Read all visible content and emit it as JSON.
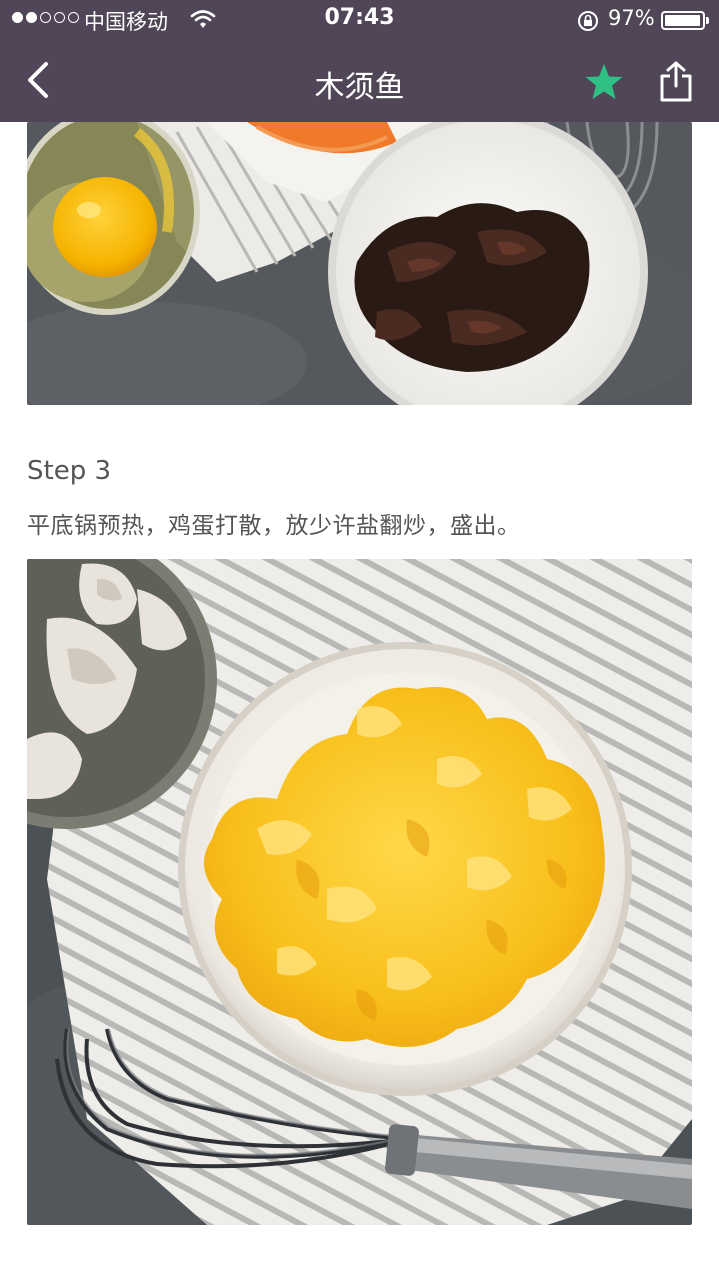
{
  "status_bar": {
    "carrier": "中国移动",
    "time": "07:43",
    "battery_percent": "97%",
    "battery_level": 0.97,
    "signal_bars_on": 2,
    "signal_bars_total": 5
  },
  "nav": {
    "title": "木须鱼",
    "back_icon": "chevron-left-icon",
    "favorite_icon": "star-icon",
    "share_icon": "share-icon",
    "favorite_color": "#2fc184"
  },
  "steps": [
    {
      "label": "Step 3",
      "text": "平底锅预热，鸡蛋打散，放少许盐翻炒，盛出。"
    }
  ],
  "colors": {
    "header_bg": "#514657",
    "text": "#555555"
  }
}
